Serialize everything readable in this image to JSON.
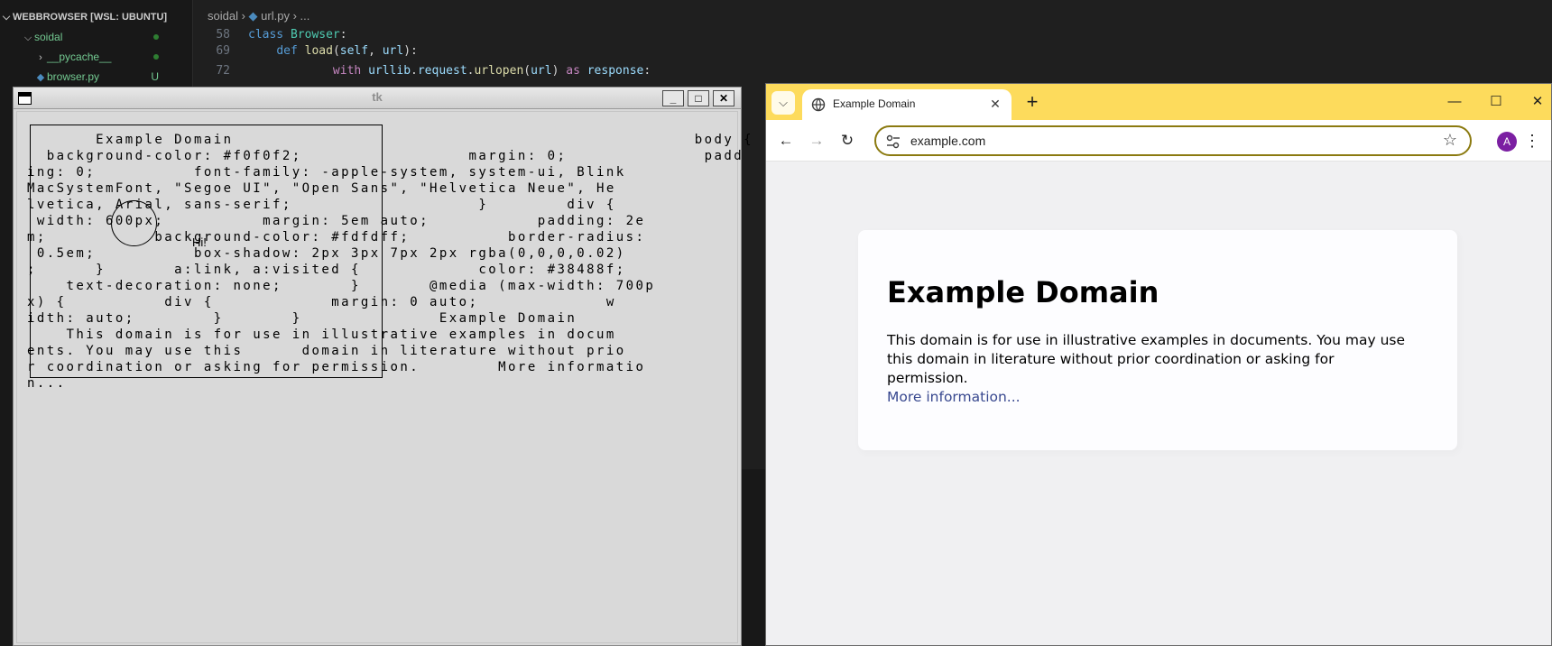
{
  "vscode": {
    "explorer_title": "WEBBROWSER [WSL: UBUNTU]",
    "tree": [
      {
        "label": "soidal",
        "color": "#73c991",
        "indent": 1,
        "chevron": "⌵",
        "status": "dot"
      },
      {
        "label": "__pycache__",
        "color": "#73c991",
        "indent": 2,
        "chevron": "›",
        "status": "dot"
      },
      {
        "label": "browser.py",
        "color": "#73c991",
        "indent": 2,
        "chevron": "",
        "status": "U"
      }
    ],
    "breadcrumb": {
      "folder": "soidal",
      "file": "url.py",
      "more": "..."
    },
    "code_lines": [
      {
        "num": "58",
        "code": "class Browser:"
      },
      {
        "num": "69",
        "code": "    def load(self, url):"
      },
      {
        "num": "72",
        "code": "            with urllib.request.urlopen(url) as response:"
      }
    ]
  },
  "tk": {
    "title": "tk",
    "buttons": {
      "minimize": "_",
      "maximize": "□",
      "close": "✕"
    },
    "hi_label": "Hi!",
    "text_lines": [
      "       Example Domain                                               body {",
      "  background-color: #f0f0f2;                 margin: 0;              padd",
      "ing: 0;          font-family: -apple-system, system-ui, Blink",
      "MacSystemFont, \"Segoe UI\", \"Open Sans\", \"Helvetica Neue\", He",
      "lvetica, Arial, sans-serif;                   }        div {",
      " width: 600px;          margin: 5em auto;           padding: 2e",
      "m;           background-color: #fdfdff;          border-radius:",
      " 0.5em;          box-shadow: 2px 3px 7px 2px rgba(0,0,0,0.02)",
      ";      }       a:link, a:visited {            color: #38488f;",
      "    text-decoration: none;       }       @media (max-width: 700p",
      "x) {          div {            margin: 0 auto;             w",
      "idth: auto;        }       }              Example Domain",
      "    This domain is for use in illustrative examples in docum",
      "ents. You may use this      domain in literature without prio",
      "r coordination or asking for permission.        More informatio",
      "n..."
    ]
  },
  "chrome": {
    "tab_title": "Example Domain",
    "url": "example.com",
    "avatar_letter": "A",
    "accent_color": "#fddb5c",
    "page": {
      "heading": "Example Domain",
      "paragraph": "This domain is for use in illustrative examples in documents. You may use this domain in literature without prior coordination or asking for permission.",
      "link": "More information..."
    },
    "icons": {
      "tab_search": "chevron-down-icon",
      "back": "arrow-left-icon",
      "forward": "arrow-right-icon",
      "reload": "reload-icon",
      "site_info": "tune-icon",
      "bookmark": "star-icon",
      "menu": "kebab-icon"
    }
  }
}
